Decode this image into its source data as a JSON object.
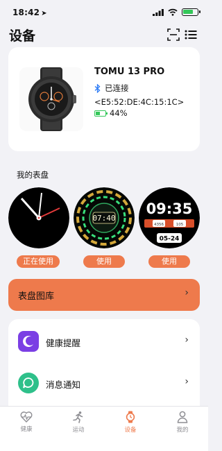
{
  "status_bar": {
    "time": "18:42",
    "location_glyph": "➤"
  },
  "header": {
    "title": "设备",
    "icons": [
      "scan-icon",
      "list-icon"
    ]
  },
  "device": {
    "name": "TOMU 13 PRO",
    "connection_status": "已连接",
    "mac": "<E5:52:DE:4C:15:1C>",
    "battery": "44%",
    "battery_level": 0.44
  },
  "watch_faces": {
    "section_label": "我的表盘",
    "items": [
      {
        "button": "正在使用",
        "active": true
      },
      {
        "button": "使用",
        "time": "07:40",
        "active": false
      },
      {
        "button": "使用",
        "time": "09:35",
        "stat_left": "4356",
        "stat_right": "105",
        "date": "05-24",
        "active": false
      }
    ]
  },
  "gallery": {
    "label": "表盘图库"
  },
  "settings": {
    "items": [
      {
        "label": "健康提醒",
        "icon": "moon-icon",
        "color": "#7b3fe4"
      },
      {
        "label": "消息通知",
        "icon": "chat-bubble-icon",
        "color": "#2ec08a"
      }
    ]
  },
  "tabbar": {
    "items": [
      {
        "label": "健康",
        "icon": "heart-pulse-icon",
        "active": false
      },
      {
        "label": "运动",
        "icon": "runner-icon",
        "active": false
      },
      {
        "label": "设备",
        "icon": "watch-icon",
        "active": true
      },
      {
        "label": "我的",
        "icon": "person-icon",
        "active": false
      }
    ]
  },
  "colors": {
    "accent": "#ee7a4c",
    "background": "#f2f2f6",
    "connected_green": "#34c759"
  }
}
